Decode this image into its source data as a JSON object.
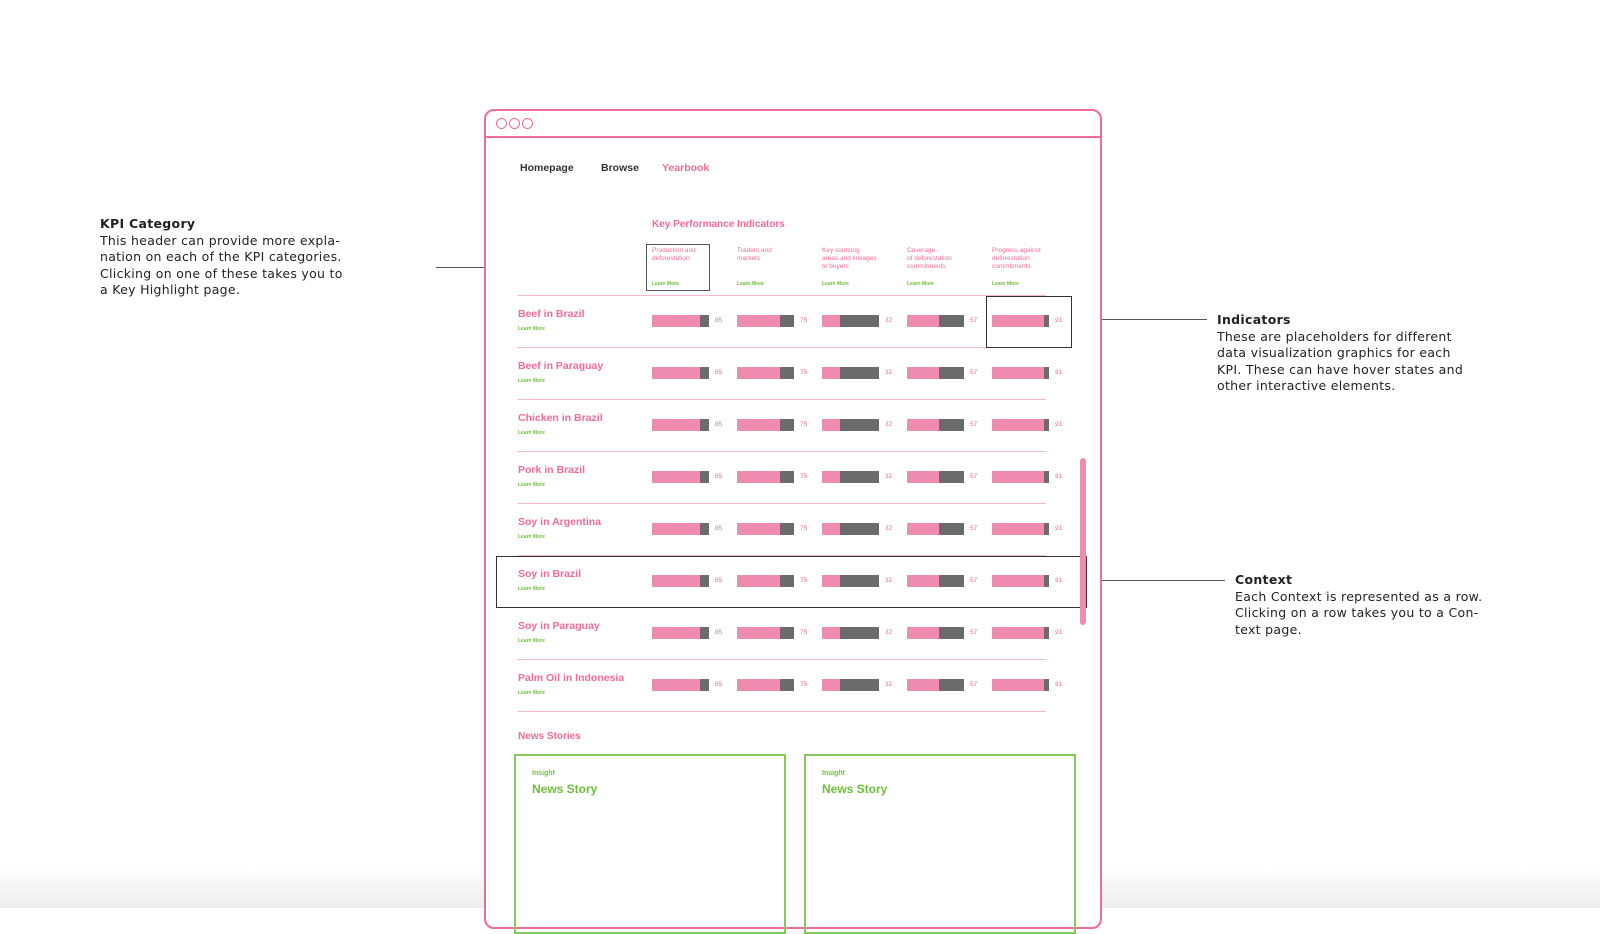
{
  "annotations": {
    "kpi_category": {
      "title": "KPI Category",
      "body": "This header can provide more expla-\nnation on each of the KPI categories.\nClicking on one of these takes you to\na Key Highlight page."
    },
    "indicators": {
      "title": "Indicators",
      "body": "These are placeholders for different\ndata visualization graphics for each\nKPI. These can have hover states and\nother interactive elements."
    },
    "context": {
      "title": "Context",
      "body": "Each Context is represented as a row.\nClicking on a row takes you to a Con-\ntext page."
    }
  },
  "nav": {
    "items": [
      {
        "label": "Homepage",
        "active": false
      },
      {
        "label": "Browse",
        "active": false
      },
      {
        "label": "Yearbook",
        "active": true
      }
    ]
  },
  "kpi": {
    "heading": "Key Performance Indicators",
    "learn_more": "Learn More",
    "categories": [
      {
        "label": "Production and\ndeforestation"
      },
      {
        "label": "Traders and\nmarkets"
      },
      {
        "label": "Key sourcing\nareas and linkages\nto buyers"
      },
      {
        "label": "Coverage\nof deforestation\ncommitments"
      },
      {
        "label": "Progress against\ndeforestation\ncommitments"
      }
    ]
  },
  "contexts": {
    "learn_more": "Learn More",
    "rows": [
      {
        "name": "Beef in Brazil",
        "values": [
          "85",
          "75",
          "32",
          "57",
          "91"
        ]
      },
      {
        "name": "Beef in Paraguay",
        "values": [
          "85",
          "75",
          "32",
          "57",
          "91"
        ]
      },
      {
        "name": "Chicken in Brazil",
        "values": [
          "85",
          "75",
          "32",
          "57",
          "91"
        ]
      },
      {
        "name": "Pork in Brazil",
        "values": [
          "85",
          "75",
          "32",
          "57",
          "91"
        ]
      },
      {
        "name": "Soy in Argentina",
        "values": [
          "85",
          "75",
          "32",
          "57",
          "91"
        ]
      },
      {
        "name": "Soy in Brazil",
        "values": [
          "85",
          "75",
          "32",
          "57",
          "91"
        ]
      },
      {
        "name": "Soy in Paraguay",
        "values": [
          "85",
          "75",
          "32",
          "57",
          "91"
        ]
      },
      {
        "name": "Palm Oil in Indonesia",
        "values": [
          "85",
          "75",
          "32",
          "57",
          "91"
        ]
      }
    ]
  },
  "news": {
    "heading": "News Stories",
    "cards": [
      {
        "kicker": "Insight",
        "title": "News Story"
      },
      {
        "kicker": "Insight",
        "title": "News Story"
      }
    ]
  },
  "colors": {
    "pink": "#ee6b9c",
    "bar_pink": "#f08bb0",
    "bar_grey": "#6b6b6b",
    "green": "#6cbf3a"
  }
}
